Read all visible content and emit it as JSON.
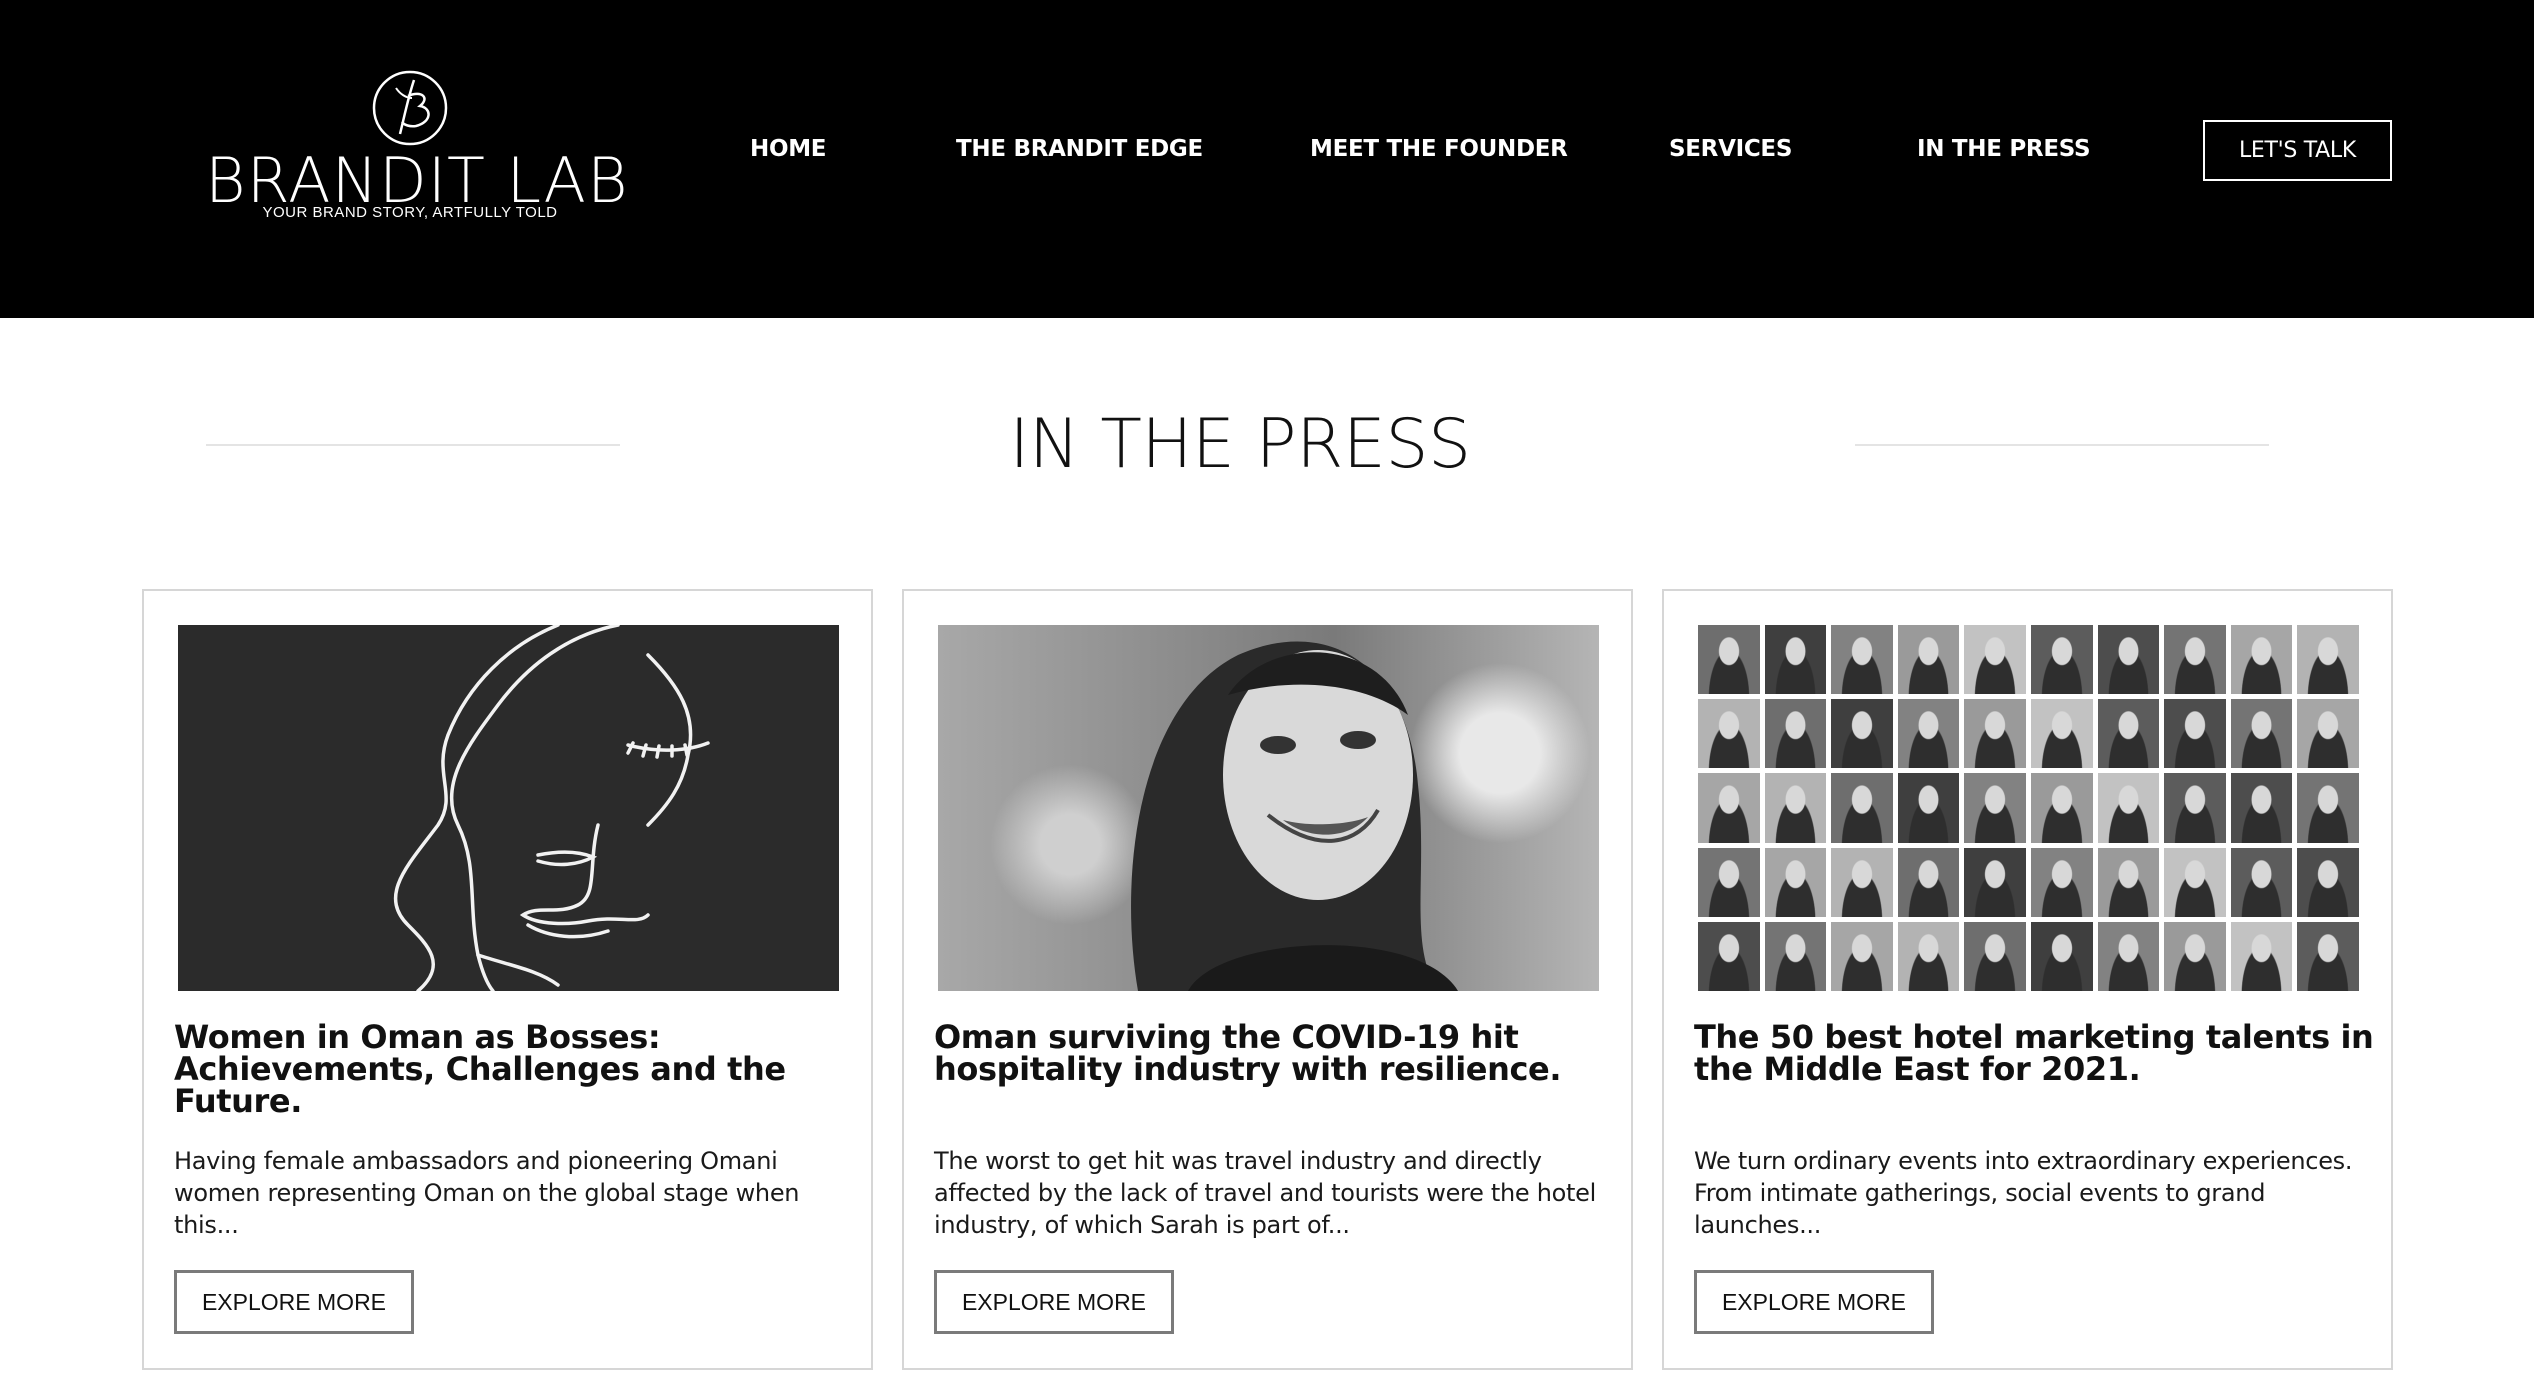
{
  "logo": {
    "name": "BRANDIT LAB",
    "tagline": "YOUR BRAND STORY, ARTFULLY TOLD"
  },
  "nav": {
    "items": [
      {
        "label": "HOME"
      },
      {
        "label": "THE BRANDIT EDGE"
      },
      {
        "label": "MEET THE FOUNDER"
      },
      {
        "label": "SERVICES"
      },
      {
        "label": "IN THE PRESS"
      }
    ],
    "cta_label": "LET'S TALK"
  },
  "section": {
    "title": "IN THE PRESS"
  },
  "cards": [
    {
      "title": "Women in Oman as Bosses: Achievements, Challenges and the Future.",
      "excerpt": "Having female ambassadors and pioneering Omani women representing Oman on the global stage when this...",
      "button_label": "EXPLORE MORE"
    },
    {
      "title": "Oman surviving the COVID-19 hit hospitality industry with resilience.",
      "excerpt": "The worst to get hit was travel industry and directly affected by the lack of travel and tourists were the hotel industry, of which Sarah is part of...",
      "button_label": "EXPLORE MORE"
    },
    {
      "title": "The 50 best hotel marketing talents in the Middle East for 2021.",
      "excerpt": "We turn ordinary events into extraordinary experiences. From intimate gatherings, social events to grand launches...",
      "button_label": "EXPLORE MORE"
    }
  ],
  "colors": {
    "header_bg": "#000000",
    "page_bg": "#ffffff",
    "card_border": "#d6d6d6",
    "button_border": "#7a7a7a"
  }
}
